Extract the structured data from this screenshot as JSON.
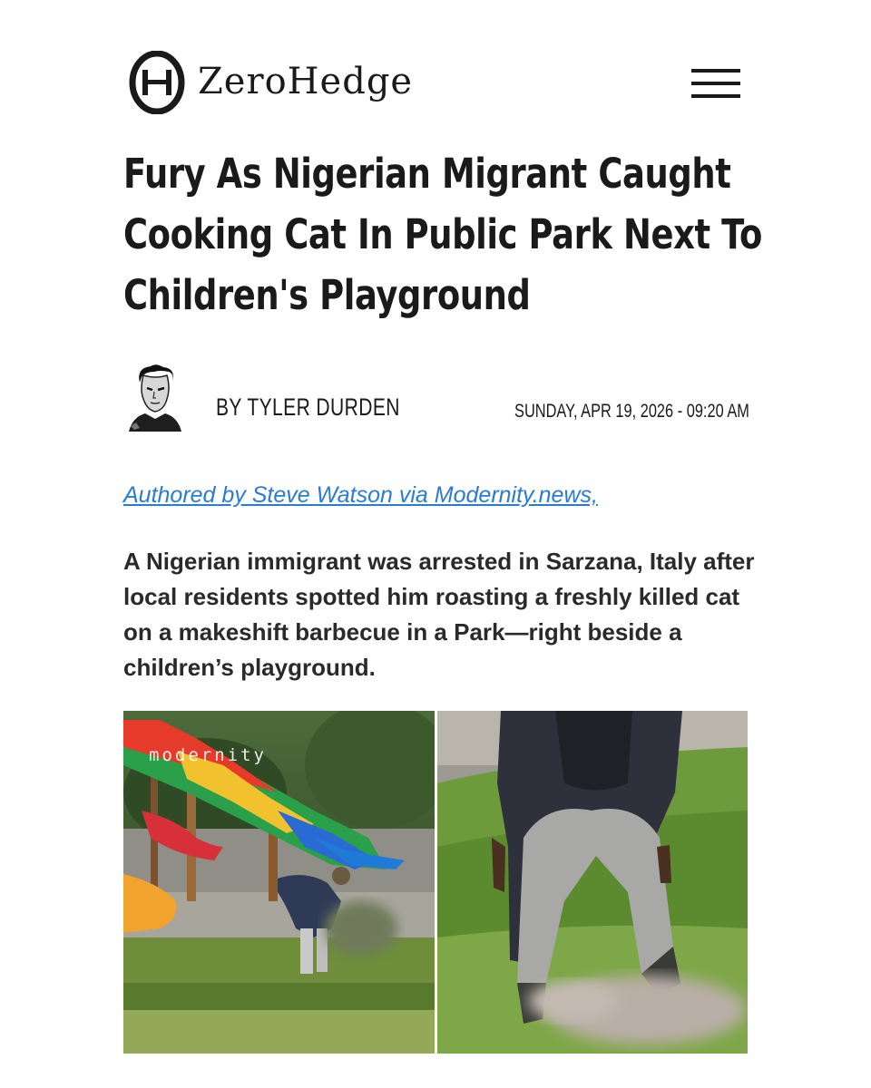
{
  "site": {
    "name": "ZeroHedge",
    "logo_icon": "zerohedge-theta-logo",
    "menu_icon": "hamburger-menu-icon"
  },
  "article": {
    "headline": "Fury As Nigerian Migrant Caught Cooking Cat In Public Park Next To Children's Playground",
    "author": "BY TYLER DURDEN",
    "date": "SUNDAY, APR 19, 2026 - 09:20 AM",
    "authored_link": "Authored by Steve Watson via Modernity.news,",
    "lede": "A Nigerian immigrant was arrested in Sarzana, Italy after local residents spotted him roasting a freshly killed cat on a makeshift barbecue in a Park—right beside a children’s playground.",
    "photo_watermark": "modernity"
  },
  "colors": {
    "text": "#1a1a1a",
    "link": "#2a7bd4",
    "background": "#ffffff"
  }
}
